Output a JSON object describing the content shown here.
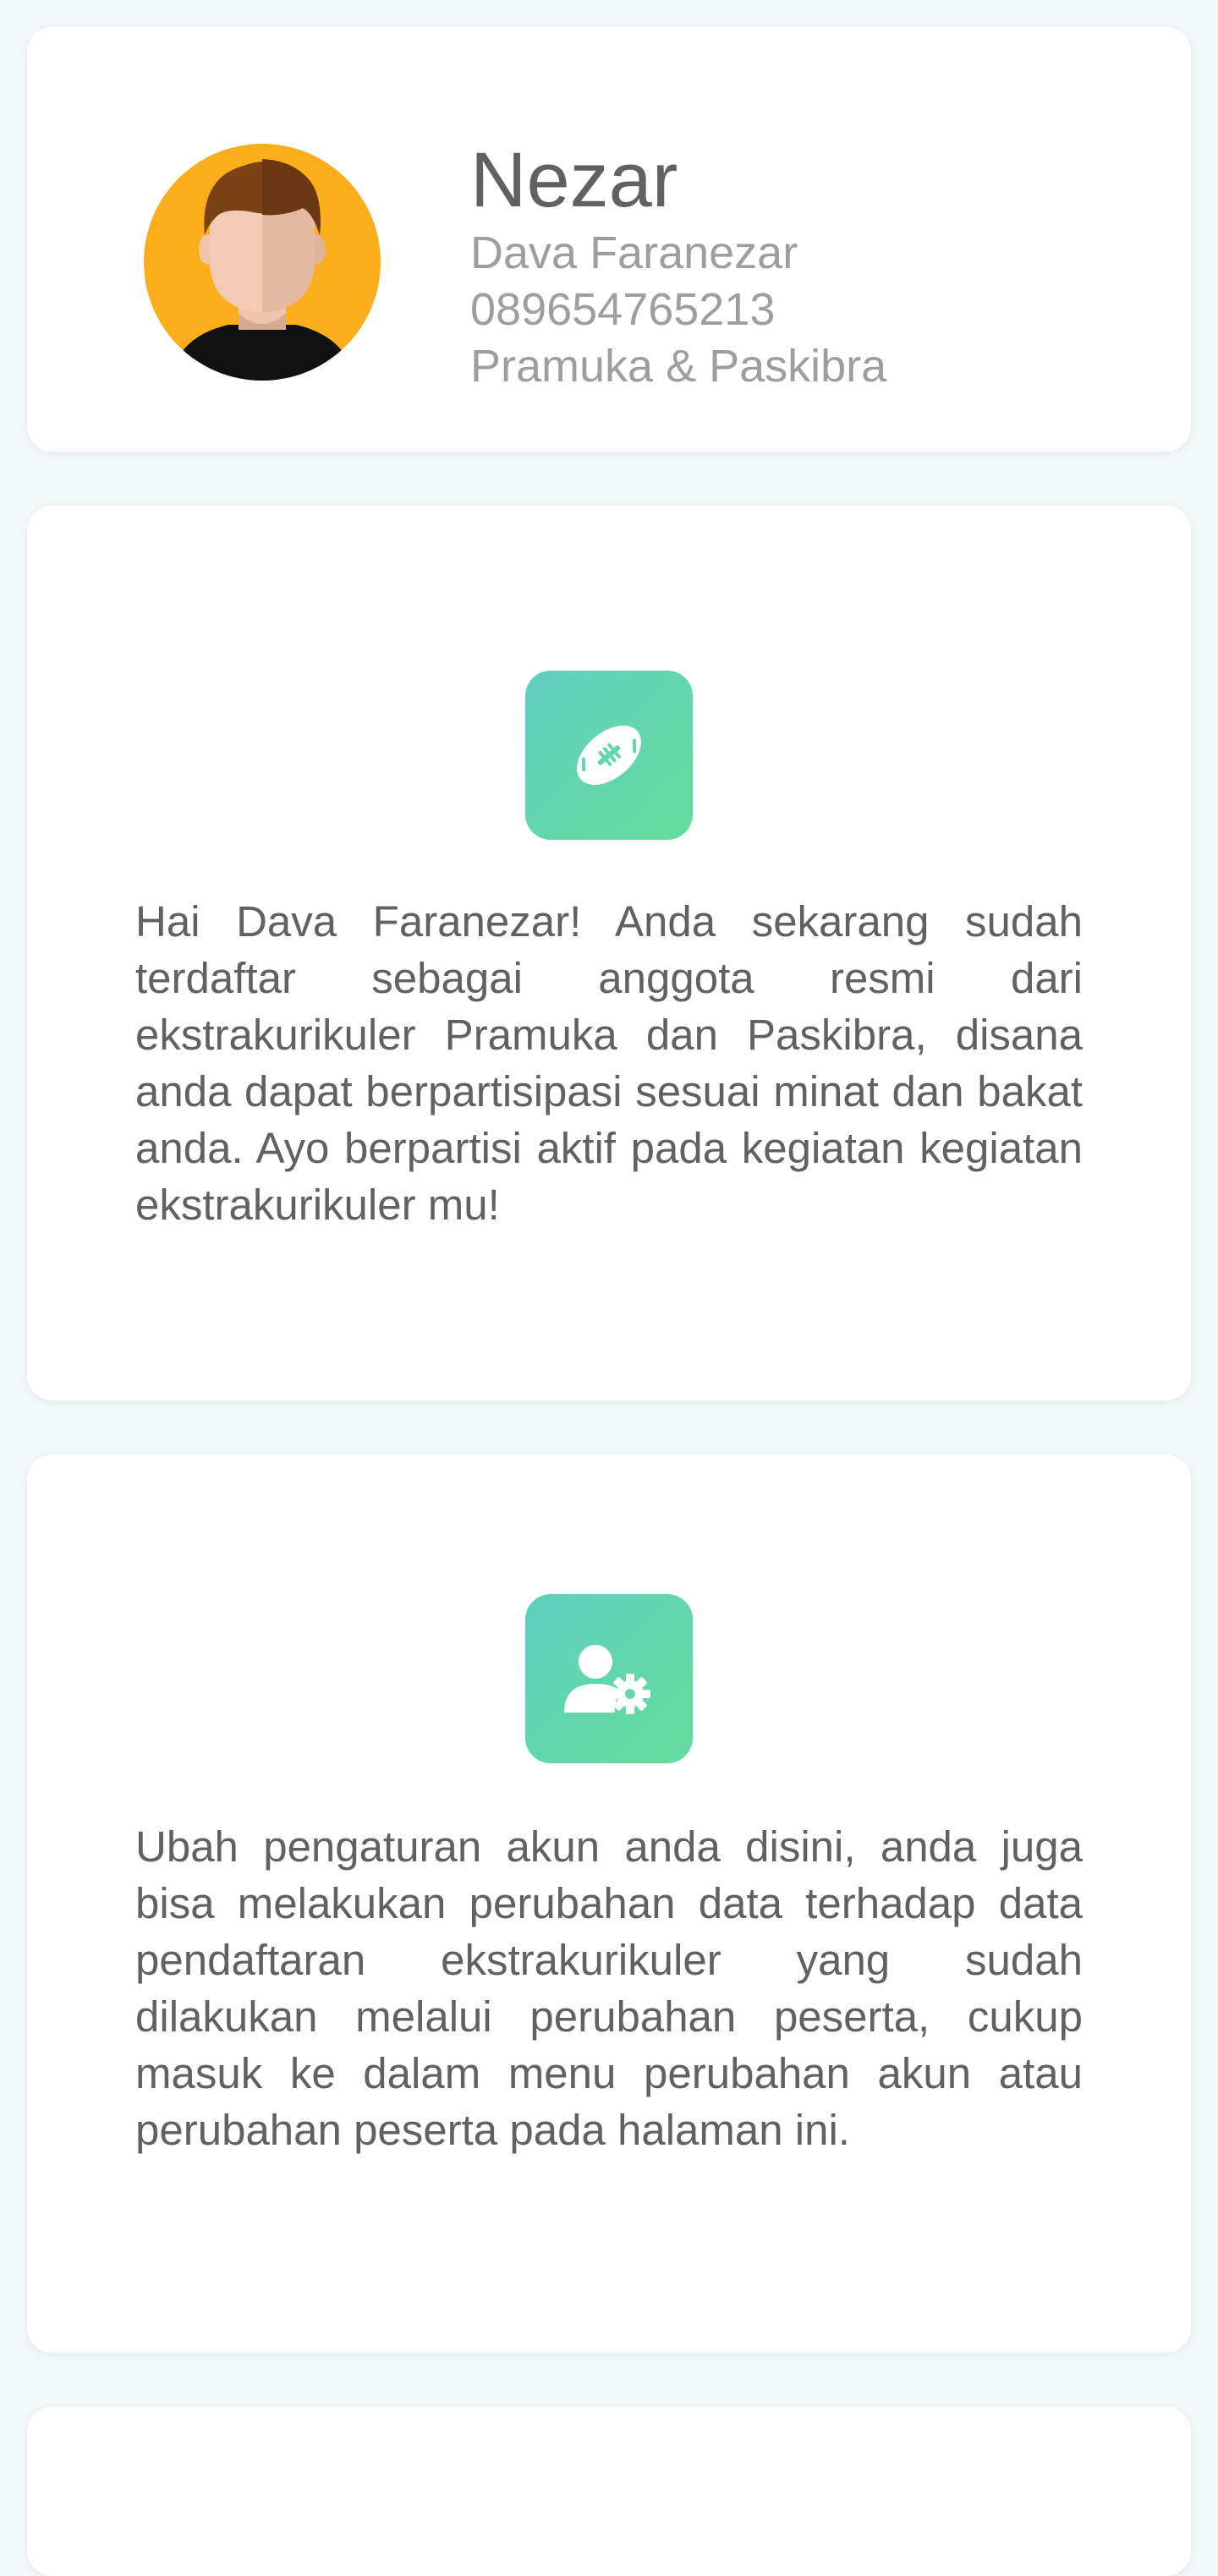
{
  "profile": {
    "nickname": "Nezar",
    "full_name": "Dava Faranezar",
    "phone": "089654765213",
    "extracurricular": "Pramuka & Paskibra",
    "avatar_icon": "user-avatar-icon"
  },
  "cards": [
    {
      "icon": "football-icon",
      "text": "Hai Dava Faranezar! Anda sekarang sudah terdaftar sebagai anggota resmi dari ekstrakurikuler Pramuka dan Paskibra, disana anda dapat berpartisipasi sesuai minat dan bakat anda. Ayo berpartisi aktif pada kegiatan kegiatan ekstrakurikuler mu!"
    },
    {
      "icon": "user-settings-icon",
      "text": "Ubah pengaturan akun anda disini, anda juga bisa melakukan perubahan data terhadap data pendaftaran ekstrakurikuler yang sudah dilakukan melalui perubahan peserta, cukup masuk ke dalam menu perubahan akun atau perubahan peserta pada halaman ini."
    }
  ],
  "colors": {
    "background": "#f2f7f7",
    "card": "#ffffff",
    "icon_gradient_start": "#5fcfbf",
    "icon_gradient_end": "#64dd9c",
    "avatar_bg": "#fbae1c",
    "title_text": "#616161",
    "secondary_text": "#9e9e9e"
  }
}
